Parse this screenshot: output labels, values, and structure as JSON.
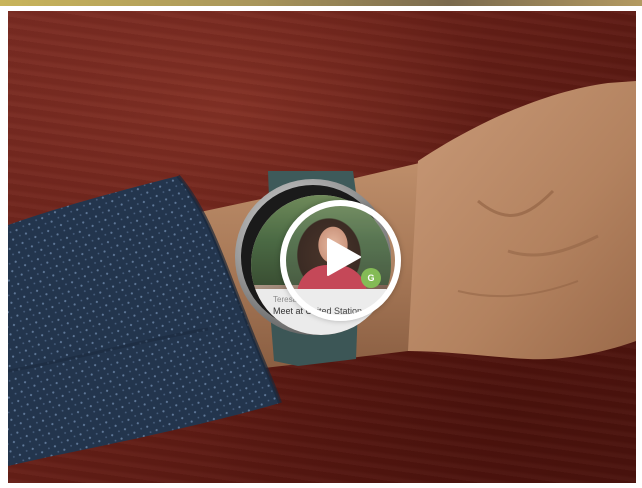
{
  "video": {
    "accent_color": "#ffffff",
    "player_state": "paused",
    "play_icon": "play-triangle-icon"
  },
  "watch": {
    "notification": {
      "sender": "Teresa",
      "message": "Meet at United Station",
      "badge_text": "G",
      "badge_color": "#7ab648"
    }
  }
}
